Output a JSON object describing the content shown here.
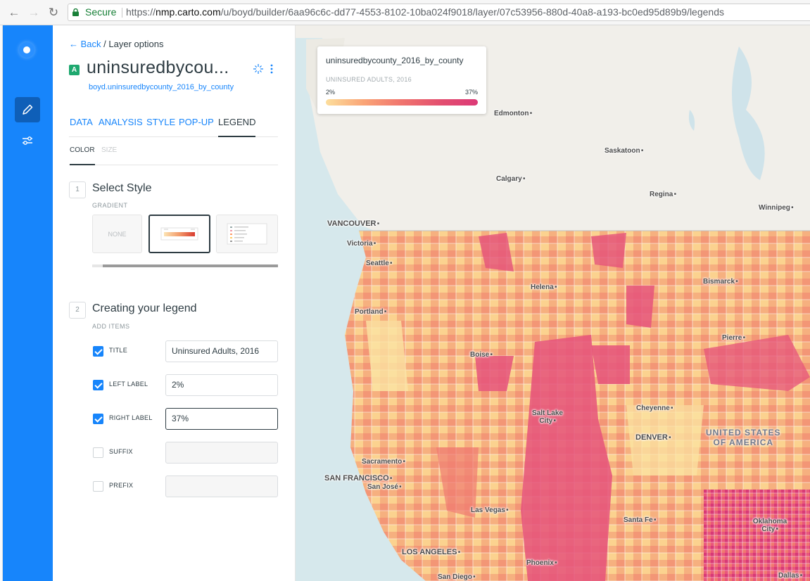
{
  "browser": {
    "secure_label": "Secure",
    "url_scheme": "https://",
    "url_host": "nmp.carto.com",
    "url_path": "/u/boyd/builder/6aa96c6c-dd77-4553-8102-10ba024f9018/layer/07c53956-880d-40a8-a193-bc0ed95d89b9/legends"
  },
  "sidebar": {
    "items": [
      {
        "icon": "pencil-icon",
        "active": true
      },
      {
        "icon": "sliders-icon",
        "active": false
      }
    ]
  },
  "panel": {
    "back_label": "Back",
    "breadcrumb_sep": "/",
    "breadcrumb_current": "Layer options",
    "layer_badge": "A",
    "layer_name": "uninsuredbycou...",
    "layer_source": "boyd.uninsuredbycounty_2016_by_county",
    "tabs": [
      "DATA",
      "ANALYSIS",
      "STYLE",
      "POP-UP",
      "LEGEND"
    ],
    "active_tab": "LEGEND",
    "subtabs": [
      "COLOR",
      "SIZE"
    ],
    "step1": {
      "number": "1",
      "title": "Select Style",
      "subtitle": "GRADIENT",
      "none_label": "NONE"
    },
    "step2": {
      "number": "2",
      "title": "Creating your legend",
      "subtitle": "ADD ITEMS",
      "items": [
        {
          "label": "TITLE",
          "checked": true,
          "value": "Uninsured Adults, 2016"
        },
        {
          "label": "LEFT LABEL",
          "checked": true,
          "value": "2%"
        },
        {
          "label": "RIGHT LABEL",
          "checked": true,
          "value": "37%"
        },
        {
          "label": "SUFFIX",
          "checked": false,
          "value": ""
        },
        {
          "label": "PREFIX",
          "checked": false,
          "value": ""
        }
      ]
    }
  },
  "map": {
    "legend": {
      "title": "uninsuredbycounty_2016_by_county",
      "subtitle": "UNINSURED ADULTS, 2016",
      "left_label": "2%",
      "right_label": "37%",
      "gradient_colors": [
        "#fcde9c",
        "#faa476",
        "#f0746e",
        "#e34f6f",
        "#dc3977"
      ]
    },
    "cities": [
      "Edmonton",
      "Saskatoon",
      "Calgary",
      "Regina",
      "Winnipeg",
      "VANCOUVER",
      "Victoria",
      "Seattle",
      "Helena",
      "Bismarck",
      "Portland",
      "Pierre",
      "Boise",
      "Cheyenne",
      "Salt Lake City",
      "DENVER",
      "Sacramento",
      "SAN FRANCISCO",
      "San José",
      "Las Vegas",
      "Santa Fe",
      "Oklahoma City",
      "LOS ANGELES",
      "Phoenix",
      "San Diego",
      "Dallas"
    ],
    "country_label": [
      "UNITED STATES",
      "OF AMERICA"
    ]
  }
}
